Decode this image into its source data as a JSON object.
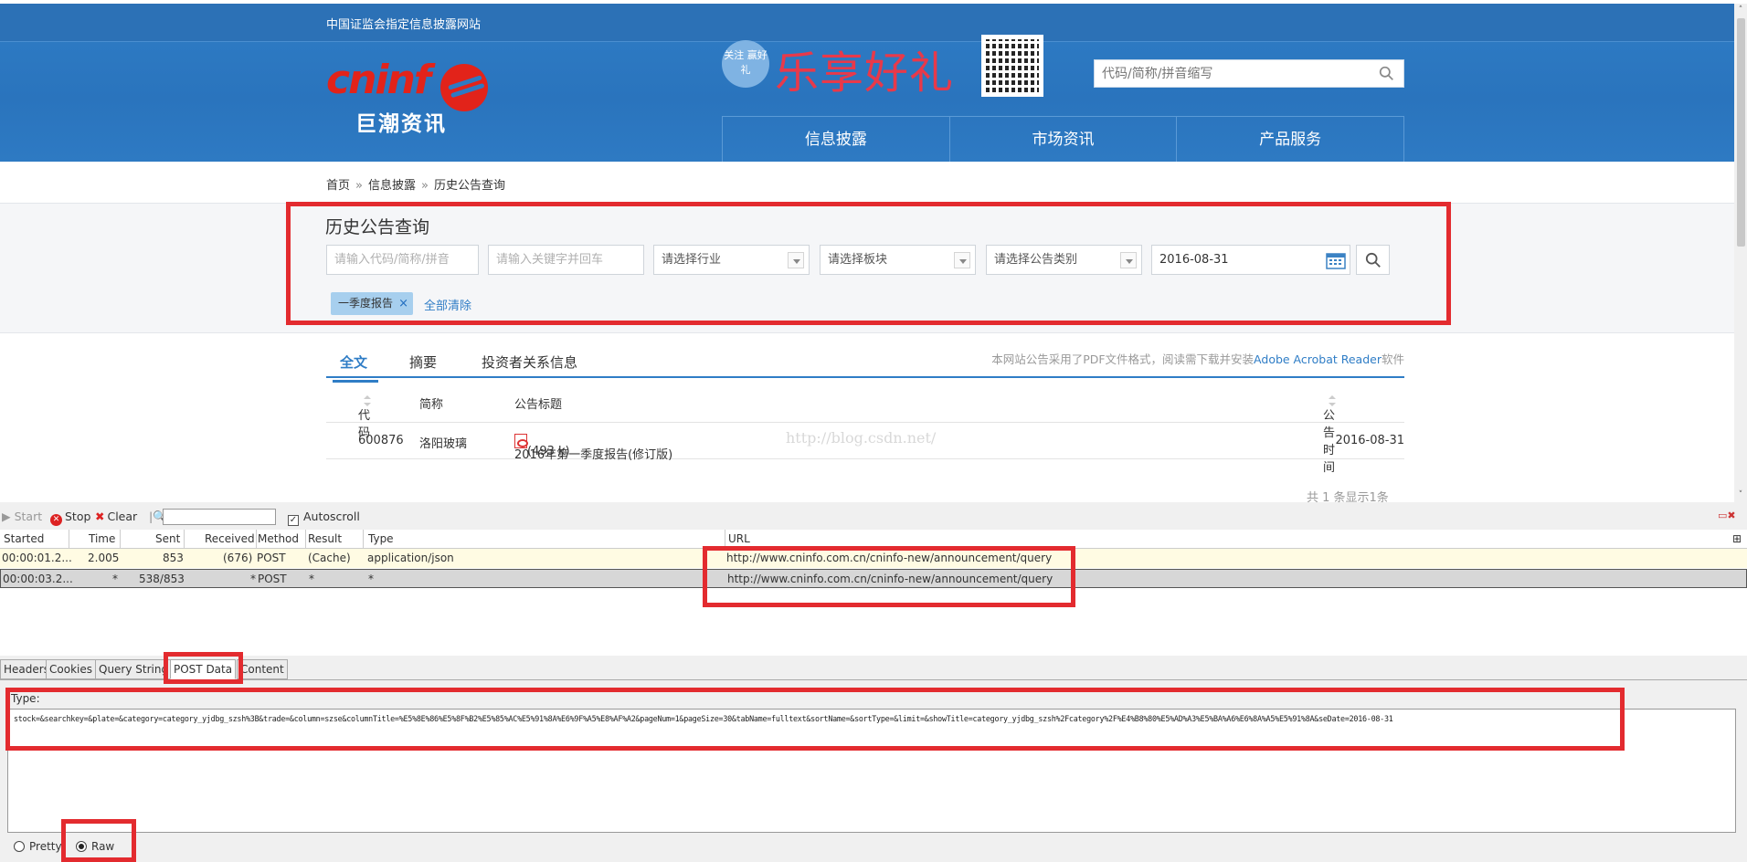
{
  "header": {
    "csrc_notice": "中国证监会指定信息披露网站",
    "logo_text": "cninf",
    "logo_cn": "巨潮资讯",
    "promo_badge": "关注 赢好礼",
    "promo_text": "乐享好礼",
    "search_placeholder": "代码/简称/拼音缩写",
    "nav": [
      "信息披露",
      "市场资讯",
      "产品服务"
    ]
  },
  "breadcrumb": [
    "首页",
    "信息披露",
    "历史公告查询"
  ],
  "breadcrumb_sep": "»",
  "query": {
    "title": "历史公告查询",
    "code_placeholder": "请输入代码/简称/拼音",
    "keyword_placeholder": "请输入关键字并回车",
    "industry": "请选择行业",
    "board": "请选择板块",
    "category": "请选择公告类别",
    "date": "2016-08-31",
    "tag": "一季度报告",
    "tag_remove": "×",
    "clear_all": "全部清除"
  },
  "results": {
    "tabs": [
      "全文",
      "摘要",
      "投资者关系信息"
    ],
    "pdf_note_prefix": "本网站公告采用了PDF文件格式，阅读需下载并安装",
    "pdf_note_link": "Adobe Acrobat Reader",
    "pdf_note_suffix": "软件",
    "columns": [
      "代码",
      "简称",
      "公告标题",
      "公告时间"
    ],
    "rows": [
      {
        "code": "600876",
        "name": "洛阳玻璃",
        "title": "2016年第一季度报告(修订版)",
        "size": "(493 k)",
        "date": "2016-08-31"
      }
    ],
    "watermark": "http://blog.csdn.net/",
    "total": "共 1 条显示1条"
  },
  "fiddler": {
    "toolbar": {
      "start": "Start",
      "stop": "Stop",
      "clear": "Clear",
      "autoscroll": "Autoscroll"
    },
    "columns": [
      "Started",
      "Time",
      "Sent",
      "Received",
      "Method",
      "Result",
      "Type",
      "URL"
    ],
    "rows": [
      {
        "started": "00:00:01.2...",
        "time": "2.005",
        "sent": "853",
        "received": "(676)",
        "method": "POST",
        "result": "(Cache)",
        "type": "application/json",
        "url": "http://www.cninfo.com.cn/cninfo-new/announcement/query"
      },
      {
        "started": "00:00:03.2...",
        "time": "*",
        "sent": "538/853",
        "received": "*",
        "method": "POST",
        "result": "*",
        "type": "*",
        "url": "http://www.cninfo.com.cn/cninfo-new/announcement/query"
      }
    ],
    "detail_tabs": [
      "Headers",
      "Cookies",
      "Query String",
      "POST Data",
      "Content"
    ],
    "type_label": "Type:",
    "post_data": "stock=&searchkey=&plate=&category=category_yjdbg_szsh%3B&trade=&column=szse&columnTitle=%E5%8E%86%E5%8F%B2%E5%85%AC%E5%91%8A%E6%9F%A5%E8%AF%A2&pageNum=1&pageSize=30&tabName=fulltext&sortName=&sortType=&limit=&showTitle=category_yjdbg_szsh%2Fcategory%2F%E4%B8%80%E5%AD%A3%E5%BA%A6%E6%8A%A5%E5%91%8A&seDate=2016-08-31",
    "view_modes": [
      "Pretty",
      "Raw"
    ],
    "selected_mode": "Raw"
  },
  "colors": {
    "brand_blue": "#2f7dc6",
    "brand_red": "#e2231a",
    "annotation_red": "#e32b2f"
  }
}
